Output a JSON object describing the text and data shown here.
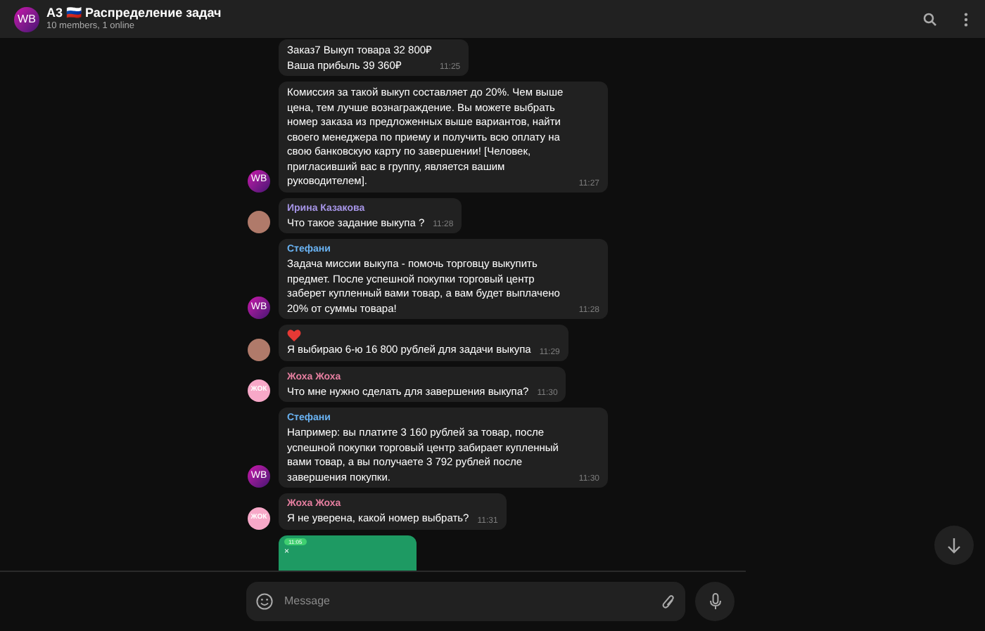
{
  "header": {
    "avatar_text": "WB",
    "title": "A3 🇷🇺 Распределение задач",
    "subtitle": "10 members, 1 online"
  },
  "messages": [
    {
      "kind": "plain",
      "text": "Заказ7 Выкуп товара 32 800₽\nВаша прибыль 39 360₽",
      "time": "11:25"
    },
    {
      "kind": "logo",
      "avatar_text": "WB",
      "text": "Комиссия за такой выкуп составляет до 20%. Чем выше цена, тем лучше вознаграждение. Вы можете выбрать номер заказа из предложенных выше вариантов, найти своего менеджера по приему и получить всю оплату на свою банковскую карту по завершении! [Человек, пригласивший вас в группу, является вашим руководителем].",
      "time": "11:27"
    },
    {
      "kind": "photo",
      "sender": "Ирина Казакова",
      "color": "#a695e7",
      "text": "Что такое задание выкупа ?",
      "time": "11:28"
    },
    {
      "kind": "logo",
      "avatar_text": "WB",
      "sender": "Стефани",
      "color": "#6ab3f3",
      "text": "Задача миссии выкупа - помочь торговцу выкупить предмет. После успешной покупки торговый центр заберет купленный вами товар, а вам будет выплачено 20% от суммы товара!",
      "time": "11:28"
    },
    {
      "kind": "photo",
      "heart": true,
      "text": "Я выбираю 6-ю 16 800 рублей для задачи выкупа",
      "time": "11:29"
    },
    {
      "kind": "letters",
      "avatar_text": "ЖОК",
      "sender": "Жоха Жоха",
      "color": "#e67fa0",
      "text": "Что мне нужно сделать для завершения выкупа?",
      "time": "11:30"
    },
    {
      "kind": "logo",
      "avatar_text": "WB",
      "sender": "Стефани",
      "color": "#6ab3f3",
      "text": "Например: вы платите 3 160 рублей  за товар, после успешной покупки торговый центр забирает купленный вами товар, а вы получаете 3 792 рублей  после завершения покупки.",
      "time": "11:30"
    },
    {
      "kind": "letters",
      "avatar_text": "ЖОК",
      "sender": "Жоха Жоха",
      "color": "#e67fa0",
      "text": "Я не уверена, какой номер выбрать?",
      "time": "11:31"
    }
  ],
  "screenshot": {
    "status_time": "11:05",
    "close": "×"
  },
  "composer": {
    "placeholder": "Message"
  }
}
